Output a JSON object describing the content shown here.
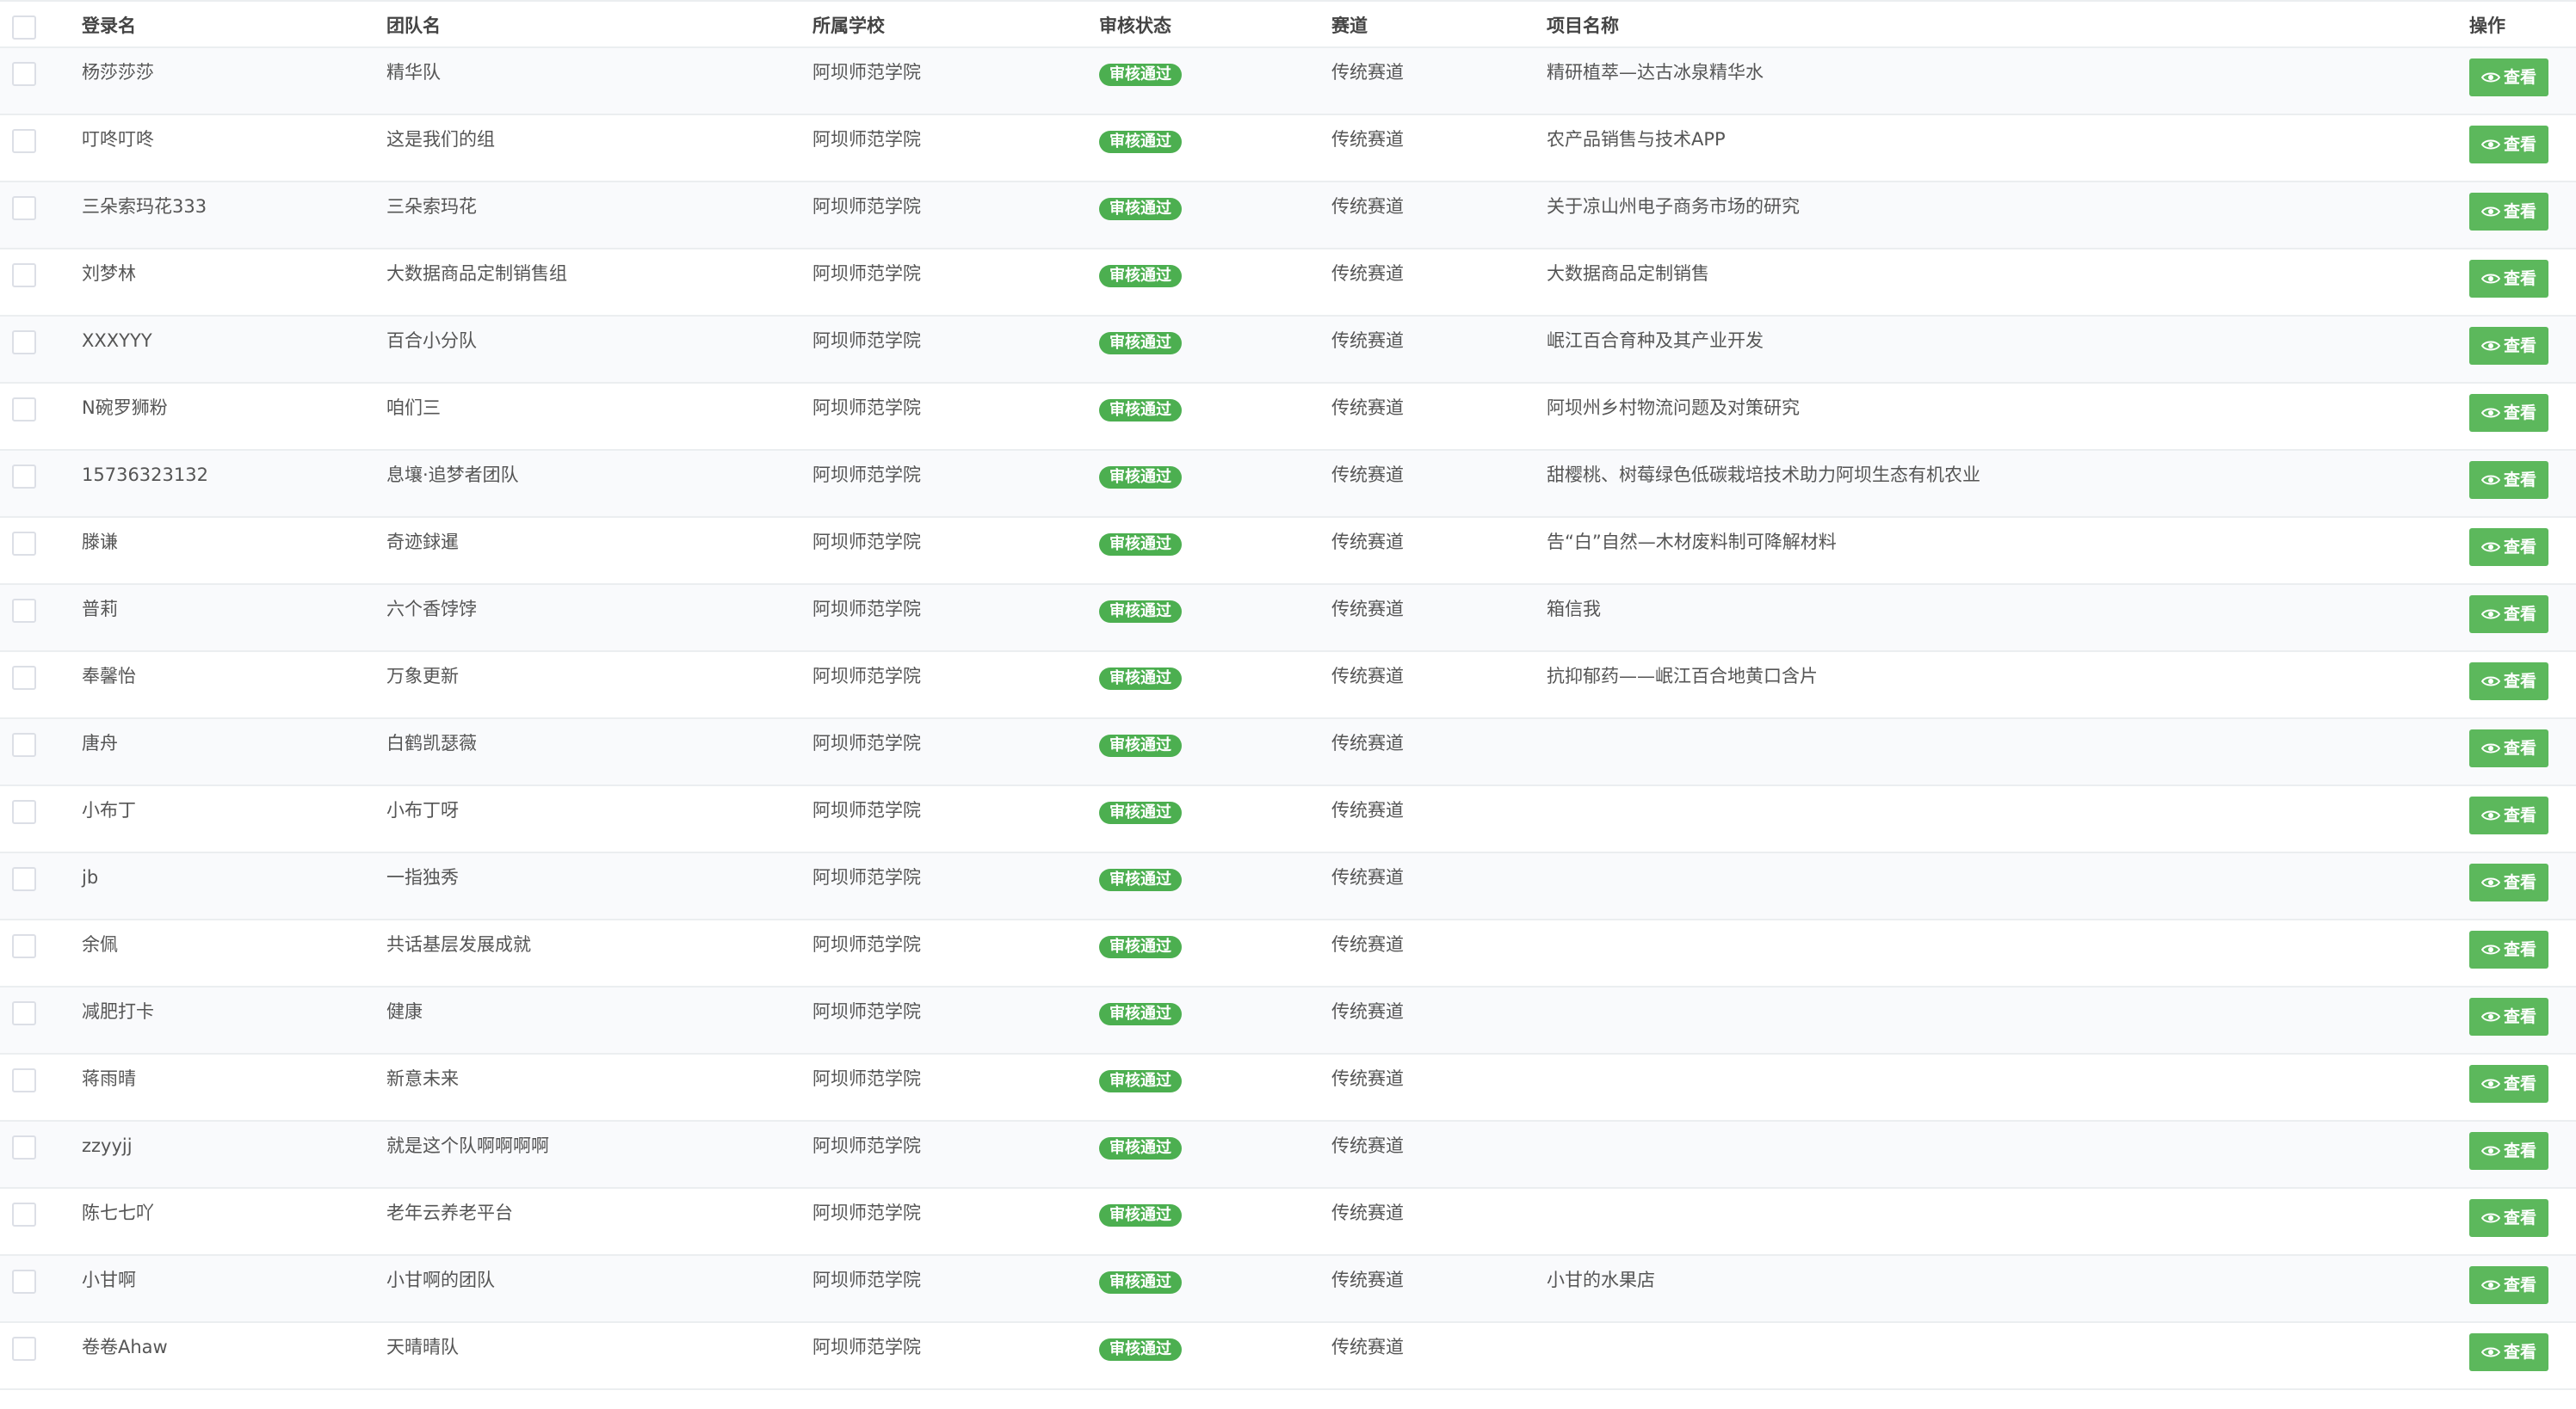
{
  "table": {
    "headers": {
      "login": "登录名",
      "team": "团队名",
      "school": "所属学校",
      "status": "审核状态",
      "track": "赛道",
      "project": "项目名称",
      "action": "操作"
    },
    "rows": [
      {
        "login": "杨莎莎莎",
        "team": "精华队",
        "school": "阿坝师范学院",
        "status": "审核通过",
        "track": "传统赛道",
        "project": "精研植萃—达古冰泉精华水",
        "action": "查看"
      },
      {
        "login": "叮咚叮咚",
        "team": "这是我们的组",
        "school": "阿坝师范学院",
        "status": "审核通过",
        "track": "传统赛道",
        "project": "农产品销售与技术APP",
        "action": "查看"
      },
      {
        "login": "三朵索玛花333",
        "team": "三朵索玛花",
        "school": "阿坝师范学院",
        "status": "审核通过",
        "track": "传统赛道",
        "project": "关于凉山州电子商务市场的研究",
        "action": "查看"
      },
      {
        "login": "刘梦林",
        "team": "大数据商品定制销售组",
        "school": "阿坝师范学院",
        "status": "审核通过",
        "track": "传统赛道",
        "project": "大数据商品定制销售",
        "action": "查看"
      },
      {
        "login": "XXXYYY",
        "team": "百合小分队",
        "school": "阿坝师范学院",
        "status": "审核通过",
        "track": "传统赛道",
        "project": "岷江百合育种及其产业开发",
        "action": "查看"
      },
      {
        "login": "N碗罗狮粉",
        "team": "咱们三",
        "school": "阿坝师范学院",
        "status": "审核通过",
        "track": "传统赛道",
        "project": "阿坝州乡村物流问题及对策研究",
        "action": "查看"
      },
      {
        "login": "15736323132",
        "team": "息壤·追梦者团队",
        "school": "阿坝师范学院",
        "status": "审核通过",
        "track": "传统赛道",
        "project": "甜樱桃、树莓绿色低碳栽培技术助力阿坝生态有机农业",
        "action": "查看"
      },
      {
        "login": "滕谦",
        "team": "奇迹銶暹",
        "school": "阿坝师范学院",
        "status": "审核通过",
        "track": "传统赛道",
        "project": "告“白”自然—木材废料制可降解材料",
        "action": "查看"
      },
      {
        "login": "普莉",
        "team": "六个香饽饽",
        "school": "阿坝师范学院",
        "status": "审核通过",
        "track": "传统赛道",
        "project": "箱信我",
        "action": "查看"
      },
      {
        "login": "奉馨怡",
        "team": "万象更新",
        "school": "阿坝师范学院",
        "status": "审核通过",
        "track": "传统赛道",
        "project": "抗抑郁药——岷江百合地黄口含片",
        "action": "查看"
      },
      {
        "login": "唐舟",
        "team": "白鹤凯瑟薇",
        "school": "阿坝师范学院",
        "status": "审核通过",
        "track": "传统赛道",
        "project": "",
        "action": "查看"
      },
      {
        "login": "小布丁",
        "team": "小布丁呀",
        "school": "阿坝师范学院",
        "status": "审核通过",
        "track": "传统赛道",
        "project": "",
        "action": "查看"
      },
      {
        "login": "jb",
        "team": "一指独秀",
        "school": "阿坝师范学院",
        "status": "审核通过",
        "track": "传统赛道",
        "project": "",
        "action": "查看"
      },
      {
        "login": "余佩",
        "team": "共话基层发展成就",
        "school": "阿坝师范学院",
        "status": "审核通过",
        "track": "传统赛道",
        "project": "",
        "action": "查看"
      },
      {
        "login": "减肥打卡",
        "team": "健康",
        "school": "阿坝师范学院",
        "status": "审核通过",
        "track": "传统赛道",
        "project": "",
        "action": "查看"
      },
      {
        "login": "蒋雨晴",
        "team": "新意未来",
        "school": "阿坝师范学院",
        "status": "审核通过",
        "track": "传统赛道",
        "project": "",
        "action": "查看"
      },
      {
        "login": "zzyyjj",
        "team": "就是这个队啊啊啊啊",
        "school": "阿坝师范学院",
        "status": "审核通过",
        "track": "传统赛道",
        "project": "",
        "action": "查看"
      },
      {
        "login": "陈七七吖",
        "team": "老年云养老平台",
        "school": "阿坝师范学院",
        "status": "审核通过",
        "track": "传统赛道",
        "project": "",
        "action": "查看"
      },
      {
        "login": "小甘啊",
        "team": "小甘啊的团队",
        "school": "阿坝师范学院",
        "status": "审核通过",
        "track": "传统赛道",
        "project": "小甘的水果店",
        "action": "查看"
      },
      {
        "login": "卷卷Ahaw",
        "team": "天晴晴队",
        "school": "阿坝师范学院",
        "status": "审核通过",
        "track": "传统赛道",
        "project": "",
        "action": "查看"
      }
    ]
  },
  "colors": {
    "status_badge": "#4caf50",
    "view_button": "#5cb85c"
  },
  "icons": {
    "view_button_icon": "eye-icon"
  }
}
